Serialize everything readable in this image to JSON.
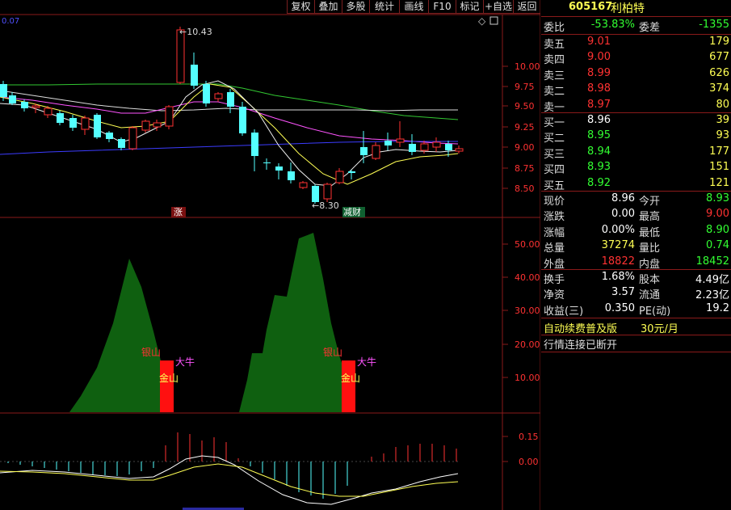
{
  "toolbar": {
    "buttons": [
      "复权",
      "叠加",
      "多股",
      "统计",
      "画线",
      "F10",
      "标记",
      "+自选",
      "返回"
    ]
  },
  "main_chart": {
    "corner_value": "0.07",
    "high_label": "10.43",
    "low_label": "8.30",
    "marker_zhang": "涨",
    "marker_jiancai": "减财",
    "y_ticks": [
      "10.00",
      "9.75",
      "9.50",
      "9.25",
      "9.00",
      "8.75",
      "8.50"
    ]
  },
  "indicator": {
    "y_ticks": [
      "50.00",
      "40.00",
      "30.00",
      "20.00",
      "10.00"
    ],
    "label_yinshan_1": "银山",
    "label_daniu_1": "大牛",
    "label_jinshan_1": "金山",
    "label_yinshan_2": "银山",
    "label_daniu_2": "大牛",
    "label_jinshan_2": "金山"
  },
  "macd": {
    "y_ticks": [
      "0.15",
      "0.00"
    ]
  },
  "quote": {
    "code": "605167",
    "name": "利柏特",
    "weibi_label": "委比",
    "weibi_value": "-53.83%",
    "weicha_label": "委差",
    "weicha_value": "-1355",
    "asks": [
      {
        "label": "卖五",
        "price": "9.01",
        "volume": "179"
      },
      {
        "label": "卖四",
        "price": "9.00",
        "volume": "677"
      },
      {
        "label": "卖三",
        "price": "8.99",
        "volume": "626"
      },
      {
        "label": "卖二",
        "price": "8.98",
        "volume": "374"
      },
      {
        "label": "卖一",
        "price": "8.97",
        "volume": "80"
      }
    ],
    "bids": [
      {
        "label": "买一",
        "price": "8.96",
        "volume": "39"
      },
      {
        "label": "买二",
        "price": "8.95",
        "volume": "93"
      },
      {
        "label": "买三",
        "price": "8.94",
        "volume": "177"
      },
      {
        "label": "买四",
        "price": "8.93",
        "volume": "151"
      },
      {
        "label": "买五",
        "price": "8.92",
        "volume": "121"
      }
    ],
    "stats": [
      {
        "l1": "现价",
        "v1": "8.96",
        "l2": "今开",
        "v2": "8.93"
      },
      {
        "l1": "涨跌",
        "v1": "0.00",
        "l2": "最高",
        "v2": "9.00"
      },
      {
        "l1": "涨幅",
        "v1": "0.00%",
        "l2": "最低",
        "v2": "8.90"
      },
      {
        "l1": "总量",
        "v1": "37274",
        "l2": "量比",
        "v2": "0.74"
      },
      {
        "l1": "外盘",
        "v1": "18822",
        "l2": "内盘",
        "v2": "18452"
      }
    ],
    "stats2": [
      {
        "l1": "换手",
        "v1": "1.68%",
        "l2": "股本",
        "v2": "4.49亿"
      },
      {
        "l1": "净资",
        "v1": "3.57",
        "l2": "流通",
        "v2": "2.23亿"
      },
      {
        "l1": "收益(三)",
        "v1": "0.350",
        "l2": "PE(动)",
        "v2": "19.2"
      }
    ],
    "promo": "自动续费普及版",
    "price_tag": "30元/月",
    "status": "行情连接已断开"
  },
  "colors": {
    "up": "#ff3232",
    "down": "#54ffff",
    "grid": "#8a1a1a",
    "yellow": "#ffff54",
    "green": "#00cc00",
    "magenta": "#ff54ff"
  }
}
